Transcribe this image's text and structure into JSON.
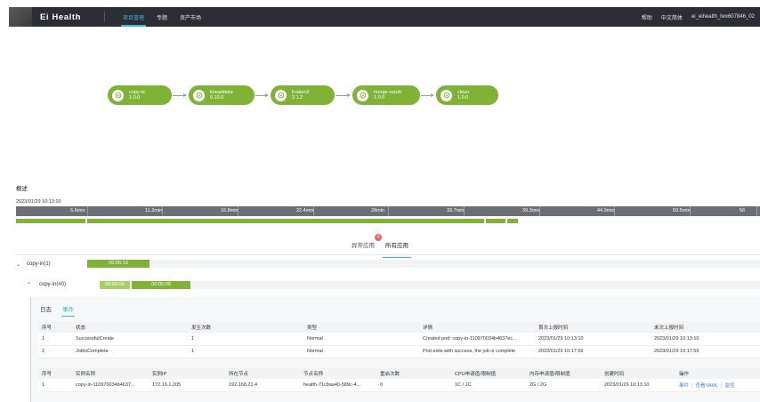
{
  "header": {
    "brand": "Ei Health",
    "nav": [
      "项目管理",
      "专题",
      "资产市场"
    ],
    "right": [
      "帮助",
      "中文简体",
      "ei_eihealth_lwx607846_02"
    ]
  },
  "workflow": [
    {
      "name": "copy-in",
      "version": "1.0.0"
    },
    {
      "name": "kneaddata",
      "version": "0.10.0"
    },
    {
      "name": "kraken2",
      "version": "2.1.2"
    },
    {
      "name": "merge-result",
      "version": "1.0.0"
    },
    {
      "name": "clean",
      "version": "1.0.0"
    }
  ],
  "overview": {
    "title": "概述",
    "start_time": "2023/01/29 10:13:10",
    "ticks": [
      "5.6min",
      "11.2min",
      "16.8min",
      "22.4min",
      "28min",
      "33.7min",
      "39.3min",
      "44.9min",
      "50.5min",
      "56"
    ]
  },
  "tabs": {
    "abnormal": "异常应用",
    "abnormal_count": "0",
    "all": "所有应用"
  },
  "jobs": {
    "job": {
      "name": "copy-in(1)",
      "duration": "00:05:13"
    },
    "pod": {
      "name": "copy-in(#0)",
      "wait": "00:00:04",
      "run": "00:05:09"
    }
  },
  "detail": {
    "subtabs": [
      "日志",
      "事件"
    ],
    "events_headers": [
      "序号",
      "状态",
      "发生次数",
      "类型",
      "详情",
      "首次上报时间",
      "末次上报时间"
    ],
    "events_rows": [
      [
        "1",
        "SuccessfulCreate",
        "1",
        "Normal",
        "Created pod: copy-in-110970034b4637ec...",
        "2023/01/29 10:13:10",
        "2023/01/29 10:13:10"
      ],
      [
        "2",
        "JobIsComplete",
        "1",
        "Normal",
        "Pod exits with success, the job is complete",
        "2023/01/29 10:17:59",
        "2023/01/29 10:17:59"
      ]
    ],
    "instances_headers": [
      "序号",
      "实例名称",
      "实例IP",
      "所在节点",
      "节点名称",
      "重启次数",
      "CPU申请值/限制值",
      "内存申请值/限制值",
      "创建时间",
      "操作"
    ],
    "instances_rows": [
      [
        "1",
        "copy-in-110970034b4637...",
        "172.16.1.205",
        "192.168.21.4",
        "health-71c9aa40-589c-4...",
        "0",
        "1C / 1C",
        "2G / 2G",
        "2023/01/29 10:13:10"
      ]
    ],
    "actions": [
      "事件",
      "查看YAML",
      "监控"
    ]
  },
  "colors": {
    "topbar": "#2a2d33",
    "accent": "#3fb1e3",
    "node_green": "#7fb236",
    "badge_red": "#f0625f",
    "link": "#3b86d8"
  }
}
